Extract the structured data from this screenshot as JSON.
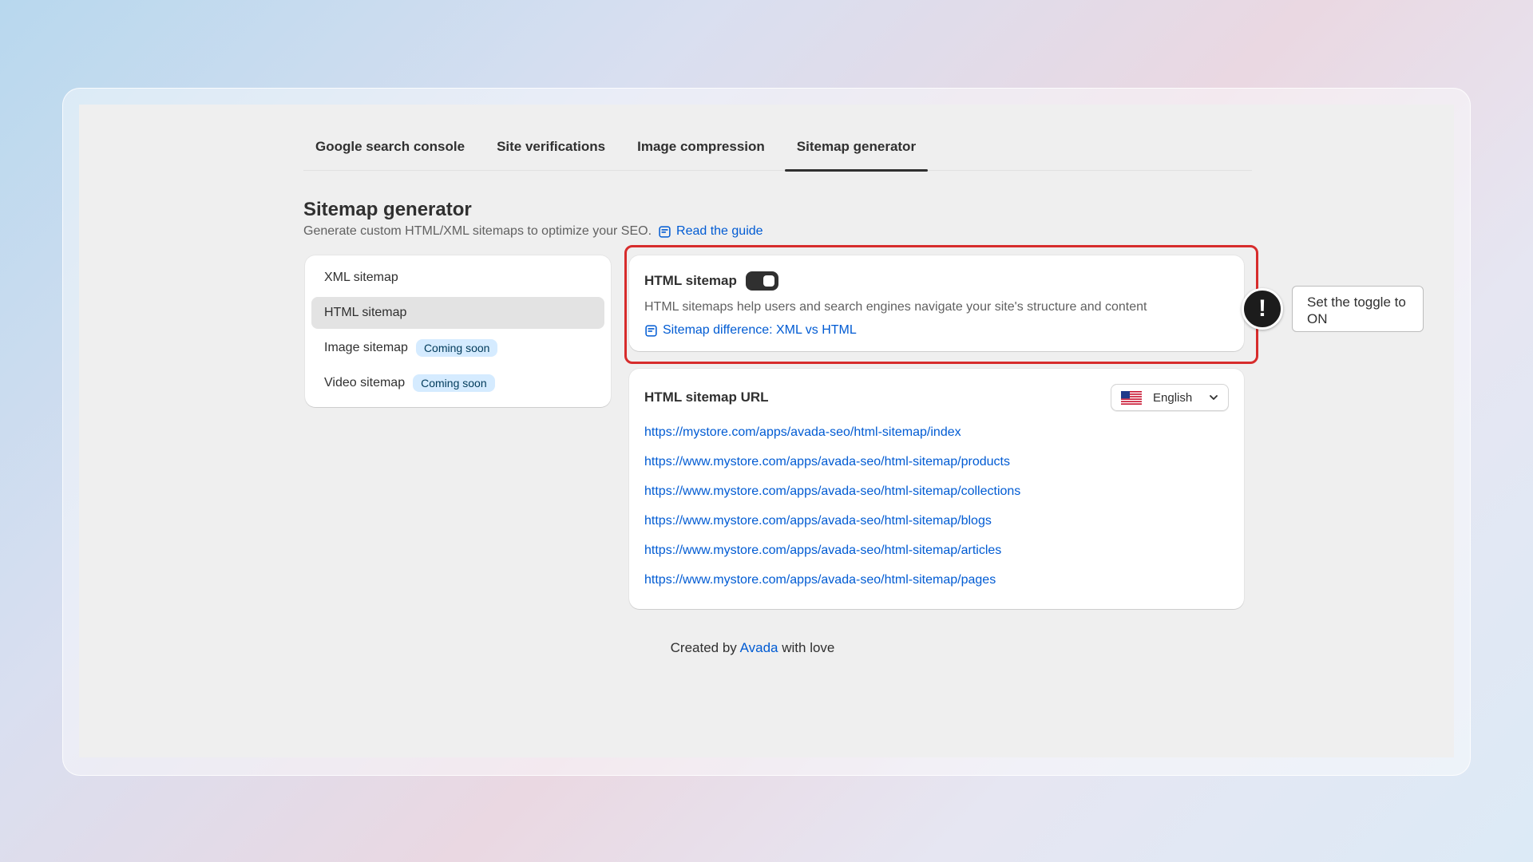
{
  "tabs": [
    {
      "label": "Google search console"
    },
    {
      "label": "Site verifications"
    },
    {
      "label": "Image compression"
    },
    {
      "label": "Sitemap generator"
    }
  ],
  "page": {
    "title": "Sitemap generator",
    "subtitle": "Generate custom HTML/XML sitemaps to optimize your SEO.",
    "guide_link": "Read the guide"
  },
  "nav": {
    "items": [
      {
        "label": "XML sitemap"
      },
      {
        "label": "HTML sitemap"
      },
      {
        "label": "Image sitemap",
        "badge": "Coming soon"
      },
      {
        "label": "Video sitemap",
        "badge": "Coming soon"
      }
    ]
  },
  "html_sitemap": {
    "title": "HTML sitemap",
    "toggle_on": true,
    "description": "HTML sitemaps help users and search engines navigate your site's structure and content",
    "diff_link": "Sitemap difference: XML vs HTML"
  },
  "url_card": {
    "title": "HTML sitemap URL",
    "language": "English",
    "urls": [
      "https://mystore.com/apps/avada-seo/html-sitemap/index",
      "https://www.mystore.com/apps/avada-seo/html-sitemap/products",
      "https://www.mystore.com/apps/avada-seo/html-sitemap/collections",
      "https://www.mystore.com/apps/avada-seo/html-sitemap/blogs",
      "https://www.mystore.com/apps/avada-seo/html-sitemap/articles",
      "https://www.mystore.com/apps/avada-seo/html-sitemap/pages"
    ]
  },
  "footer": {
    "prefix": "Created by",
    "brand": "Avada",
    "suffix": "with love"
  },
  "callout": {
    "icon": "!",
    "text": "Set the toggle to ON"
  },
  "colors": {
    "link": "#005bd3",
    "highlight": "#d72c2c",
    "badge_bg": "#d5ebff"
  }
}
